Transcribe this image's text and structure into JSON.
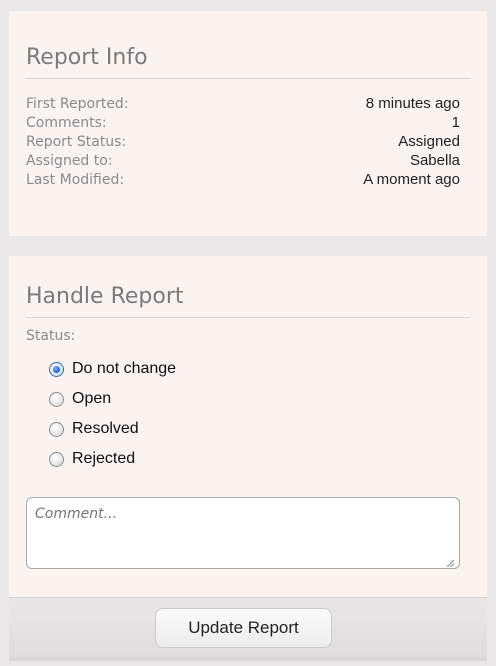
{
  "report_info": {
    "title": "Report Info",
    "rows": [
      {
        "label": "First Reported:",
        "value": "8 minutes ago"
      },
      {
        "label": "Comments:",
        "value": "1"
      },
      {
        "label": "Report Status:",
        "value": "Assigned"
      },
      {
        "label": "Assigned to:",
        "value": "Sabella"
      },
      {
        "label": "Last Modified:",
        "value": "A moment ago"
      }
    ]
  },
  "handle_report": {
    "title": "Handle Report",
    "status_label": "Status:",
    "options": [
      {
        "label": "Do not change",
        "checked": true
      },
      {
        "label": "Open",
        "checked": false
      },
      {
        "label": "Resolved",
        "checked": false
      },
      {
        "label": "Rejected",
        "checked": false
      }
    ],
    "comment_placeholder": "Comment...",
    "comment_value": ""
  },
  "footer": {
    "update_label": "Update Report"
  },
  "colors": {
    "panel_background": "#fbf3ef",
    "page_background": "#eae8e8",
    "label_gray": "#8b8b8b",
    "radio_selected": "#1b5fd1"
  }
}
